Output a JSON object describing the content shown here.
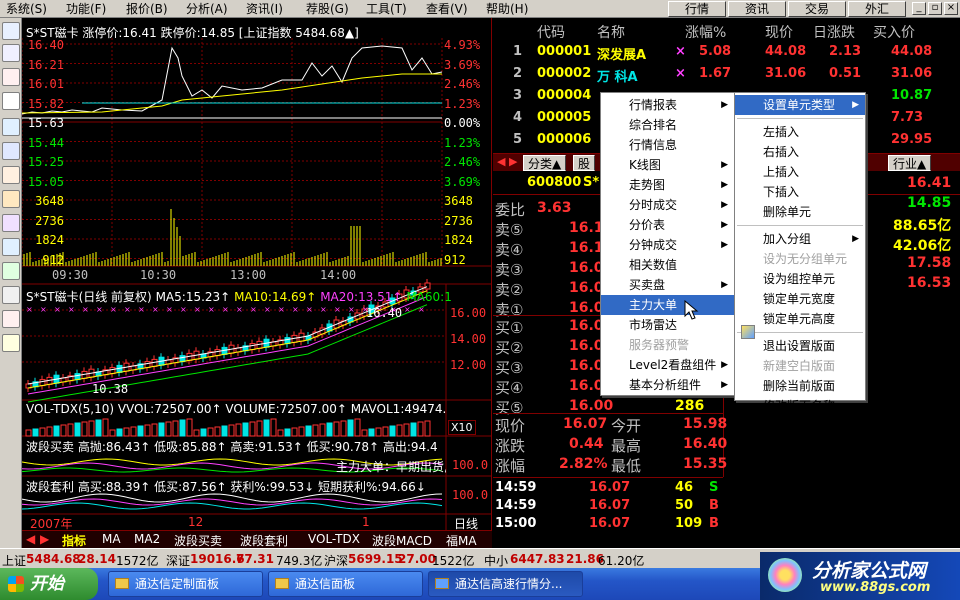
{
  "menubar": {
    "items": [
      "系统(S)",
      "功能(F)",
      "报价(B)",
      "分析(A)",
      "资讯(I)",
      "荐股(G)",
      "工具(T)",
      "查看(V)",
      "帮助(H)"
    ],
    "tabs": [
      "行情",
      "资讯",
      "交易",
      "外汇"
    ]
  },
  "chart": {
    "intraday_header": "S*ST磁卡 涨停价:16.41 跌停价:14.85 [上证指数 5484.68▲]",
    "price_labels": [
      "16.40",
      "16.21",
      "16.01",
      "15.82",
      "15.63",
      "15.44",
      "15.25",
      "15.05"
    ],
    "pct_labels": [
      "4.93%",
      "3.69%",
      "2.46%",
      "1.23%",
      "0.00%",
      "1.23%",
      "2.46%",
      "3.69%"
    ],
    "vol_labels": [
      "3648",
      "2736",
      "1824",
      "912"
    ],
    "time_labels": [
      "09:30",
      "10:30",
      "13:00",
      "14:00"
    ],
    "kline_header": "S*ST磁卡(日线 前复权)",
    "ma_labels": [
      "MA5:15.23↑",
      "MA10:14.69↑",
      "MA20:13.51↑",
      "MA60:1"
    ],
    "kline_axis": [
      "16.00",
      "14.00",
      "12.00"
    ],
    "kline_hi": "16.40",
    "kline_lo": "10.38",
    "vol_tdx_header": "VOL-TDX(5,10) VVOL:72507.00↑ VOLUME:72507.00↑ MAVOL1:49474.",
    "x10": "X10",
    "bd_header": "波段买卖 高抛:86.43↑ 低吸:85.88↑ 高卖:91.53↑ 低买:90.78↑ 高出:94.4",
    "bd_overlay": "主力大单：早期出货,量涨防!",
    "bt_header": "波段套利 高买:88.39↑ 低买:87.56↑ 获利%:99.53↓ 短期获利%:94.66↓",
    "bt_axis": "100.0",
    "date_labels": [
      "2007年",
      "12",
      "1"
    ],
    "period": "日线",
    "bottom_tabs": [
      "指标",
      "MA",
      "MA2",
      "波段买卖",
      "波段套利",
      "VOL-TDX",
      "波段MACD",
      "福MA"
    ]
  },
  "quote": {
    "headers": [
      "代码",
      "名称",
      "涨幅%",
      "现价",
      "日涨跌",
      "买入价"
    ],
    "rows": [
      {
        "idx": "1",
        "code": "000001",
        "name": "深发展A",
        "mark": "×",
        "pct": "5.08",
        "price": "44.08",
        "chg": "2.13",
        "bid": "44.08"
      },
      {
        "idx": "2",
        "code": "000002",
        "name": "万 科A",
        "mark": "×",
        "pct": "1.67",
        "price": "31.06",
        "chg": "0.51",
        "bid": "31.06"
      },
      {
        "idx": "3",
        "code": "000004",
        "name": "",
        "mark": "",
        "pct": "",
        "price": "",
        "chg": "",
        "bid": "10.87"
      },
      {
        "idx": "4",
        "code": "000005",
        "name": "",
        "mark": "",
        "pct": "",
        "price": "",
        "chg": "",
        "bid": "7.73"
      },
      {
        "idx": "5",
        "code": "000006",
        "name": "",
        "mark": "",
        "pct": "",
        "price": "",
        "chg": "",
        "bid": "29.95"
      }
    ]
  },
  "tabbar": {
    "left": "分类▲",
    "left2": "股",
    "right": "行业▲"
  },
  "panel": {
    "code": "600800",
    "name": "S*S",
    "weibi_label": "委比",
    "weibi_value": "3.63",
    "sells": [
      {
        "label": "卖⑤",
        "price": "16.1"
      },
      {
        "label": "卖④",
        "price": "16.1"
      },
      {
        "label": "卖③",
        "price": "16.0"
      },
      {
        "label": "卖②",
        "price": "16.0"
      },
      {
        "label": "卖①",
        "price": "16.0"
      }
    ],
    "buys": [
      {
        "label": "买①",
        "price": "16.0"
      },
      {
        "label": "买②",
        "price": "16.0"
      },
      {
        "label": "买③",
        "price": "16.0"
      },
      {
        "label": "买④",
        "price": "16.0"
      },
      {
        "label": "买⑤",
        "price": "16.00",
        "vol": "286"
      }
    ],
    "right_values": [
      "16.41",
      "14.85",
      "88.65亿",
      "42.06亿",
      "17.58",
      "16.53"
    ],
    "now_label": "现价",
    "now": "16.07",
    "open_label": "今开",
    "open": "15.98",
    "chg_label": "涨跌",
    "chg": "0.44",
    "high_label": "最高",
    "high": "16.40",
    "pct_label": "涨幅",
    "pct": "2.82%",
    "low_label": "最低",
    "low": "15.35"
  },
  "ticks": [
    {
      "time": "14:59",
      "price": "16.07",
      "vol": "46",
      "bs": "S"
    },
    {
      "time": "14:59",
      "price": "16.07",
      "vol": "50",
      "bs": "B"
    },
    {
      "time": "15:00",
      "price": "16.07",
      "vol": "109",
      "bs": "B"
    }
  ],
  "context_menu": {
    "items": [
      {
        "label": "行情报表",
        "sub": true,
        "disabled": false
      },
      {
        "label": "综合排名",
        "sub": false,
        "disabled": false
      },
      {
        "label": "行情信息",
        "sub": false,
        "disabled": false
      },
      {
        "label": "K线图",
        "sub": true,
        "disabled": false
      },
      {
        "label": "走势图",
        "sub": true,
        "disabled": false
      },
      {
        "label": "分时成交",
        "sub": true,
        "disabled": false
      },
      {
        "label": "分价表",
        "sub": true,
        "disabled": false
      },
      {
        "label": "分钟成交",
        "sub": true,
        "disabled": false
      },
      {
        "label": "相关数值",
        "sub": false,
        "disabled": false
      },
      {
        "label": "买卖盘",
        "sub": true,
        "disabled": false
      },
      {
        "label": "主力大单",
        "sub": false,
        "disabled": false,
        "highlight": true
      },
      {
        "label": "市场雷达",
        "sub": false,
        "disabled": false
      },
      {
        "label": "服务器预警",
        "sub": false,
        "disabled": true
      },
      {
        "label": "Level2看盘组件",
        "sub": true,
        "disabled": false
      },
      {
        "label": "基本分析组件",
        "sub": true,
        "disabled": false
      }
    ]
  },
  "sub_menu": {
    "items": [
      {
        "label": "设置单元类型",
        "sub": true,
        "disabled": false,
        "highlight": true
      },
      {
        "label": "左插入",
        "disabled": false
      },
      {
        "label": "右插入",
        "disabled": false
      },
      {
        "label": "上插入",
        "disabled": false
      },
      {
        "label": "下插入",
        "disabled": false
      },
      {
        "label": "删除单元",
        "disabled": false
      },
      {
        "label": "加入分组",
        "sub": true,
        "disabled": false
      },
      {
        "label": "设为无分组单元",
        "disabled": true
      },
      {
        "label": "设为组控单元",
        "disabled": false
      },
      {
        "label": "锁定单元宽度",
        "disabled": false
      },
      {
        "label": "锁定单元高度",
        "disabled": false
      },
      {
        "label": "退出设置版面",
        "disabled": false
      },
      {
        "label": "新建空白版面",
        "disabled": true
      },
      {
        "label": "删除当前版面",
        "disabled": false
      },
      {
        "label": "修改版面名称",
        "disabled": false
      }
    ]
  },
  "statusbar": {
    "items": [
      "上证",
      "5484.68",
      "28.14",
      "1572亿",
      "深证",
      "19016.6",
      "77.31",
      "749.3亿",
      "沪深",
      "5699.15",
      "27.00",
      "1522亿",
      "中小",
      "6447.83",
      "21.86",
      "61.20亿"
    ]
  },
  "taskbar": {
    "start": "开始",
    "tasks": [
      "通达信定制面板",
      "通达信面板",
      "通达信高速行情分..."
    ],
    "logo": "分析家公式网",
    "logo_url": "www.88gs.com"
  },
  "colors": {
    "up": "#ff3232",
    "down": "#00e600",
    "cyan": "#00ffff",
    "yellow": "#ffff00",
    "white": "#ffffff",
    "magenta": "#ff40ff",
    "grid": "#800000"
  }
}
